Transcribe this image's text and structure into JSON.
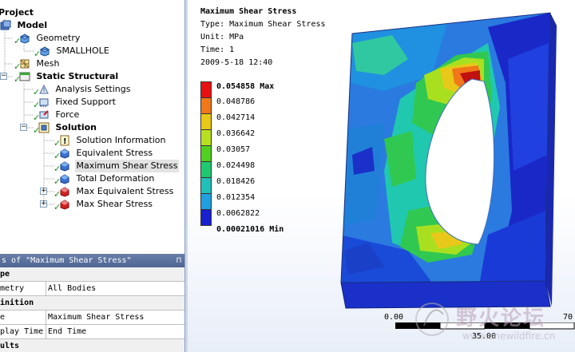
{
  "tree": {
    "project": "Project",
    "model": "Model",
    "geometry": "Geometry",
    "smallhole": "SMALLHOLE",
    "mesh": "Mesh",
    "static_structural": "Static Structural",
    "analysis_settings": "Analysis Settings",
    "fixed_support": "Fixed Support",
    "force": "Force",
    "solution": "Solution",
    "solution_items": [
      "Solution Information",
      "Equivalent Stress",
      "Maximum Shear Stress",
      "Total Deformation",
      "Max Equivalent Stress",
      "Max Shear Stress"
    ]
  },
  "details": {
    "header": "s of \"Maximum Shear Stress\"",
    "pin": "⊓",
    "rows": [
      {
        "key": "pe",
        "value": "",
        "category": true
      },
      {
        "key": "metry",
        "value": "All Bodies",
        "category": false
      },
      {
        "key": "inition",
        "value": "",
        "category": true
      },
      {
        "key": "e",
        "value": "Maximum Shear Stress",
        "category": false
      },
      {
        "key": "play Time",
        "value": "End Time",
        "category": false
      },
      {
        "key": "ults",
        "value": "",
        "category": true
      }
    ]
  },
  "result": {
    "title": "Maximum Shear Stress",
    "type_line": "Type: Maximum Shear Stress",
    "unit_line": "Unit: MPa",
    "time_line": "Time: 1",
    "date_line": "2009-5-18 12:40"
  },
  "legend": {
    "max_suffix": "Max",
    "min_suffix": "Min",
    "labels": [
      "0.054858",
      "0.048786",
      "0.042714",
      "0.036642",
      "0.03057",
      "0.024498",
      "0.018426",
      "0.012354",
      "0.0062822",
      "0.00021016"
    ],
    "colors": [
      "#e81010",
      "#f07818",
      "#e8c818",
      "#b8e020",
      "#50d020",
      "#20c870",
      "#20c0b8",
      "#20a0e0",
      "#2060f0",
      "#1820d0"
    ]
  },
  "scale": {
    "left": "0.00",
    "mid": "35.00",
    "right": "70"
  },
  "watermark": {
    "cn": "野火论坛",
    "url": "www.onewildfire.cn"
  }
}
